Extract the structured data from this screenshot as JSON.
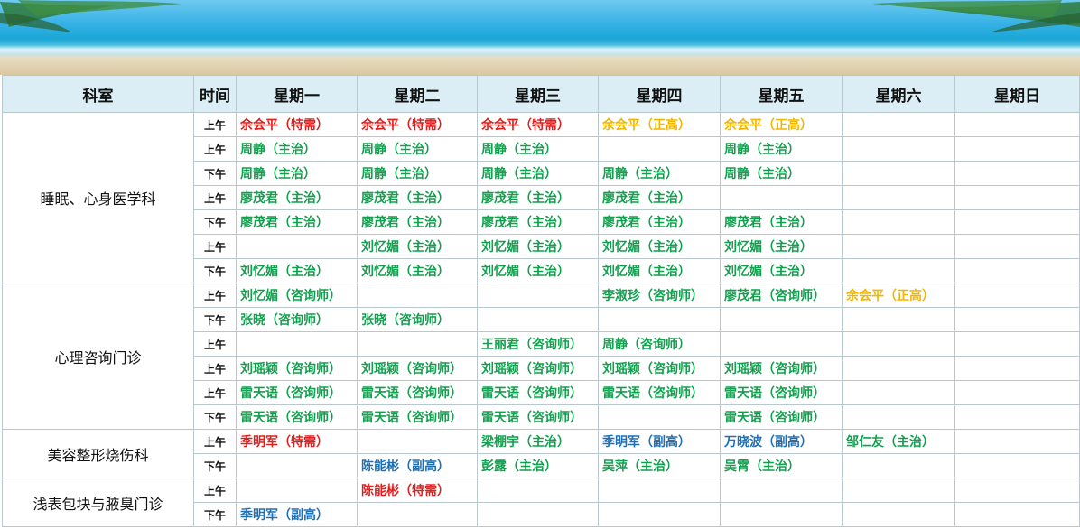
{
  "headers": [
    "科室",
    "时间",
    "星期一",
    "星期二",
    "星期三",
    "星期四",
    "星期五",
    "星期六",
    "星期日"
  ],
  "colors": {
    "red": "#e01f1f",
    "yellow": "#f2b600",
    "green": "#12a04f",
    "blue": "#1f6fb5"
  },
  "rows": [
    {
      "dept": "睡眠、心身医学科",
      "span": 7,
      "time": "上午",
      "cells": [
        {
          "t": "余会平（特需）",
          "c": "red"
        },
        {
          "t": "余会平（特需）",
          "c": "red"
        },
        {
          "t": "余会平（特需）",
          "c": "red"
        },
        {
          "t": "余会平（正高）",
          "c": "yellow"
        },
        {
          "t": "余会平（正高）",
          "c": "yellow"
        },
        {
          "t": "",
          "c": ""
        },
        {
          "t": "",
          "c": ""
        }
      ]
    },
    {
      "time": "上午",
      "cells": [
        {
          "t": "周静（主治）",
          "c": "green"
        },
        {
          "t": "周静（主治）",
          "c": "green"
        },
        {
          "t": "周静（主治）",
          "c": "green"
        },
        {
          "t": "",
          "c": ""
        },
        {
          "t": "周静（主治）",
          "c": "green"
        },
        {
          "t": "",
          "c": ""
        },
        {
          "t": "",
          "c": ""
        }
      ]
    },
    {
      "time": "下午",
      "cells": [
        {
          "t": "周静（主治）",
          "c": "green"
        },
        {
          "t": "周静（主治）",
          "c": "green"
        },
        {
          "t": "周静（主治）",
          "c": "green"
        },
        {
          "t": "周静（主治）",
          "c": "green"
        },
        {
          "t": "周静（主治）",
          "c": "green"
        },
        {
          "t": "",
          "c": ""
        },
        {
          "t": "",
          "c": ""
        }
      ]
    },
    {
      "time": "上午",
      "cells": [
        {
          "t": "廖茂君（主治）",
          "c": "green"
        },
        {
          "t": "廖茂君（主治）",
          "c": "green"
        },
        {
          "t": "廖茂君（主治）",
          "c": "green"
        },
        {
          "t": "廖茂君（主治）",
          "c": "green"
        },
        {
          "t": "",
          "c": ""
        },
        {
          "t": "",
          "c": ""
        },
        {
          "t": "",
          "c": ""
        }
      ]
    },
    {
      "time": "下午",
      "cells": [
        {
          "t": "廖茂君（主治）",
          "c": "green"
        },
        {
          "t": "廖茂君（主治）",
          "c": "green"
        },
        {
          "t": "廖茂君（主治）",
          "c": "green"
        },
        {
          "t": "廖茂君（主治）",
          "c": "green"
        },
        {
          "t": "廖茂君（主治）",
          "c": "green"
        },
        {
          "t": "",
          "c": ""
        },
        {
          "t": "",
          "c": ""
        }
      ]
    },
    {
      "time": "上午",
      "cells": [
        {
          "t": "",
          "c": ""
        },
        {
          "t": "刘忆媚（主治）",
          "c": "green"
        },
        {
          "t": "刘忆媚（主治）",
          "c": "green"
        },
        {
          "t": "刘忆媚（主治）",
          "c": "green"
        },
        {
          "t": "刘忆媚（主治）",
          "c": "green"
        },
        {
          "t": "",
          "c": ""
        },
        {
          "t": "",
          "c": ""
        }
      ]
    },
    {
      "time": "下午",
      "cells": [
        {
          "t": "刘忆媚（主治）",
          "c": "green"
        },
        {
          "t": "刘忆媚（主治）",
          "c": "green"
        },
        {
          "t": "刘忆媚（主治）",
          "c": "green"
        },
        {
          "t": "刘忆媚（主治）",
          "c": "green"
        },
        {
          "t": "刘忆媚（主治）",
          "c": "green"
        },
        {
          "t": "",
          "c": ""
        },
        {
          "t": "",
          "c": ""
        }
      ]
    },
    {
      "dept": "心理咨询门诊",
      "span": 6,
      "time": "上午",
      "cells": [
        {
          "t": "刘忆媚（咨询师）",
          "c": "green"
        },
        {
          "t": "",
          "c": ""
        },
        {
          "t": "",
          "c": ""
        },
        {
          "t": "李淑珍（咨询师）",
          "c": "green"
        },
        {
          "t": "廖茂君（咨询师）",
          "c": "green"
        },
        {
          "t": "余会平（正高）",
          "c": "yellow"
        },
        {
          "t": "",
          "c": ""
        }
      ]
    },
    {
      "time": "下午",
      "cells": [
        {
          "t": "张晓（咨询师）",
          "c": "green"
        },
        {
          "t": "张晓（咨询师）",
          "c": "green"
        },
        {
          "t": "",
          "c": ""
        },
        {
          "t": "",
          "c": ""
        },
        {
          "t": "",
          "c": ""
        },
        {
          "t": "",
          "c": ""
        },
        {
          "t": "",
          "c": ""
        }
      ]
    },
    {
      "time": "上午",
      "cells": [
        {
          "t": "",
          "c": ""
        },
        {
          "t": "",
          "c": ""
        },
        {
          "t": "王丽君（咨询师）",
          "c": "green"
        },
        {
          "t": "周静（咨询师）",
          "c": "green"
        },
        {
          "t": "",
          "c": ""
        },
        {
          "t": "",
          "c": ""
        },
        {
          "t": "",
          "c": ""
        }
      ]
    },
    {
      "time": "上午",
      "cells": [
        {
          "t": "刘瑶颖（咨询师）",
          "c": "green"
        },
        {
          "t": "刘瑶颖（咨询师）",
          "c": "green"
        },
        {
          "t": "刘瑶颖（咨询师）",
          "c": "green"
        },
        {
          "t": "刘瑶颖（咨询师）",
          "c": "green"
        },
        {
          "t": "刘瑶颖（咨询师）",
          "c": "green"
        },
        {
          "t": "",
          "c": ""
        },
        {
          "t": "",
          "c": ""
        }
      ]
    },
    {
      "time": "上午",
      "cells": [
        {
          "t": "雷天语（咨询师）",
          "c": "green"
        },
        {
          "t": "雷天语（咨询师）",
          "c": "green"
        },
        {
          "t": "雷天语（咨询师）",
          "c": "green"
        },
        {
          "t": "雷天语（咨询师）",
          "c": "green"
        },
        {
          "t": "雷天语（咨询师）",
          "c": "green"
        },
        {
          "t": "",
          "c": ""
        },
        {
          "t": "",
          "c": ""
        }
      ]
    },
    {
      "time": "下午",
      "cells": [
        {
          "t": "雷天语（咨询师）",
          "c": "green"
        },
        {
          "t": "雷天语（咨询师）",
          "c": "green"
        },
        {
          "t": "雷天语（咨询师）",
          "c": "green"
        },
        {
          "t": "",
          "c": ""
        },
        {
          "t": "雷天语（咨询师）",
          "c": "green"
        },
        {
          "t": "",
          "c": ""
        },
        {
          "t": "",
          "c": ""
        }
      ]
    },
    {
      "dept": "美容整形烧伤科",
      "span": 2,
      "time": "上午",
      "cells": [
        {
          "t": "季明军（特需）",
          "c": "red"
        },
        {
          "t": "",
          "c": ""
        },
        {
          "t": "梁棚宇（主治）",
          "c": "green"
        },
        {
          "t": "季明军（副高）",
          "c": "blue"
        },
        {
          "t": "万晓波（副高）",
          "c": "blue"
        },
        {
          "t": "邹仁友（主治）",
          "c": "green"
        },
        {
          "t": "",
          "c": ""
        }
      ]
    },
    {
      "time": "下午",
      "cells": [
        {
          "t": "",
          "c": ""
        },
        {
          "t": "陈能彬（副高）",
          "c": "blue"
        },
        {
          "t": "彭露（主治）",
          "c": "green"
        },
        {
          "t": "吴萍（主治）",
          "c": "green"
        },
        {
          "t": "吴霄（主治）",
          "c": "green"
        },
        {
          "t": "",
          "c": ""
        },
        {
          "t": "",
          "c": ""
        }
      ]
    },
    {
      "dept": "浅表包块与腋臭门诊",
      "span": 2,
      "time": "上午",
      "cells": [
        {
          "t": "",
          "c": ""
        },
        {
          "t": "陈能彬（特需）",
          "c": "red"
        },
        {
          "t": "",
          "c": ""
        },
        {
          "t": "",
          "c": ""
        },
        {
          "t": "",
          "c": ""
        },
        {
          "t": "",
          "c": ""
        },
        {
          "t": "",
          "c": ""
        }
      ]
    },
    {
      "time": "下午",
      "cells": [
        {
          "t": "季明军（副高）",
          "c": "blue"
        },
        {
          "t": "",
          "c": ""
        },
        {
          "t": "",
          "c": ""
        },
        {
          "t": "",
          "c": ""
        },
        {
          "t": "",
          "c": ""
        },
        {
          "t": "",
          "c": ""
        },
        {
          "t": "",
          "c": ""
        }
      ]
    }
  ]
}
